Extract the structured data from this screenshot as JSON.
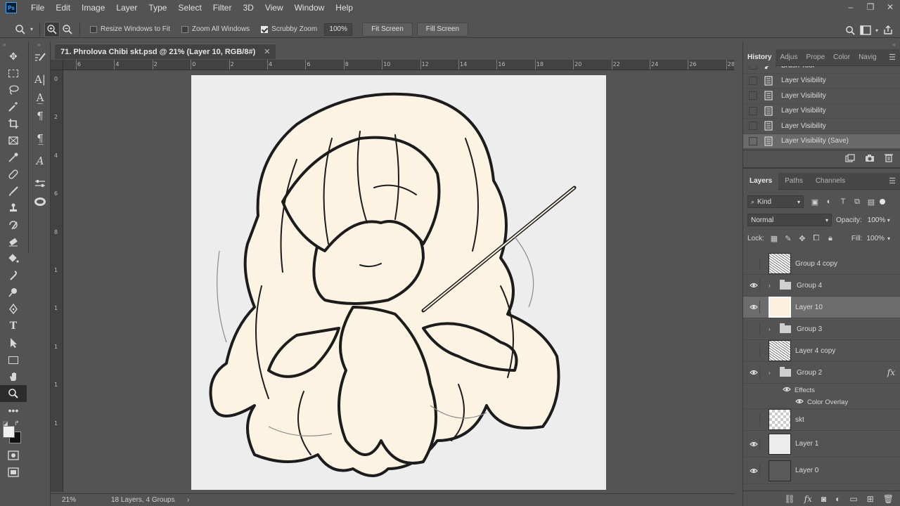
{
  "app": {
    "logo": "Ps"
  },
  "menu": [
    "File",
    "Edit",
    "Image",
    "Layer",
    "Type",
    "Select",
    "Filter",
    "3D",
    "View",
    "Window",
    "Help"
  ],
  "window_controls": {
    "minimize": "–",
    "restore": "❐",
    "close": "✕"
  },
  "options": {
    "resize_windows_label": "Resize Windows to Fit",
    "resize_windows_checked": false,
    "zoom_all_label": "Zoom All Windows",
    "zoom_all_checked": false,
    "scrubby_label": "Scrubby Zoom",
    "scrubby_checked": true,
    "zoom_value": "100%",
    "fit_screen_label": "Fit Screen",
    "fill_screen_label": "Fill Screen"
  },
  "document": {
    "tab_title": "71. Phrolova Chibi skt.psd @ 21% (Layer 10, RGB/8#)",
    "close": "✕"
  },
  "ruler_h": [
    "6",
    "4",
    "2",
    "0",
    "2",
    "4",
    "6",
    "8",
    "10",
    "12",
    "14",
    "16",
    "18",
    "20",
    "22",
    "24",
    "26",
    "28"
  ],
  "ruler_v": [
    "0",
    "2",
    "4",
    "6",
    "8",
    "1",
    "1",
    "1",
    "1",
    "1"
  ],
  "status": {
    "zoom": "21%",
    "info": "18 Layers, 4 Groups",
    "arrow": "›"
  },
  "history": {
    "tabs": [
      "History",
      "Adjus",
      "Prope",
      "Color",
      "Navig"
    ],
    "items": [
      {
        "label": "Brush Tool",
        "icon": "brush-icon"
      },
      {
        "label": "Layer Visibility",
        "icon": "layer-visibility-icon"
      },
      {
        "label": "Layer Visibility",
        "icon": "layer-visibility-icon"
      },
      {
        "label": "Layer Visibility",
        "icon": "layer-visibility-icon"
      },
      {
        "label": "Layer Visibility",
        "icon": "layer-visibility-icon"
      },
      {
        "label": "Layer Visibility (Save)",
        "icon": "layer-visibility-icon",
        "current": true
      }
    ]
  },
  "layers_panel": {
    "tabs": [
      "Layers",
      "Paths",
      "Channels"
    ],
    "kind_label": "Kind",
    "blend_mode": "Normal",
    "opacity_label": "Opacity:",
    "opacity_value": "100%",
    "lock_label": "Lock:",
    "fill_label": "Fill:",
    "fill_value": "100%",
    "layers": [
      {
        "name": "Group 4 copy",
        "type": "layer",
        "thumb": "sketch",
        "visible": false
      },
      {
        "name": "Group 4",
        "type": "group",
        "visible": true
      },
      {
        "name": "Layer 10",
        "type": "layer",
        "thumb": "cream",
        "visible": true,
        "selected": true
      },
      {
        "name": "Group 3",
        "type": "group",
        "visible": false
      },
      {
        "name": "Layer 4 copy",
        "type": "layer",
        "thumb": "sketch",
        "visible": false
      },
      {
        "name": "Group 2",
        "type": "group",
        "visible": true,
        "fx": "fx"
      },
      {
        "name": "skt",
        "type": "layer",
        "thumb": "check",
        "visible": false
      },
      {
        "name": "Layer 1",
        "type": "layer",
        "thumb": "light",
        "visible": true
      },
      {
        "name": "Layer 0",
        "type": "layer",
        "thumb": "dark",
        "visible": true
      }
    ],
    "effects_label": "Effects",
    "color_overlay_label": "Color Overlay"
  },
  "colors": {
    "ui_bg": "#535353",
    "canvas_bg": "#ededed",
    "fill_cream": "#fdf3e3",
    "ink": "#1a1a1a"
  }
}
